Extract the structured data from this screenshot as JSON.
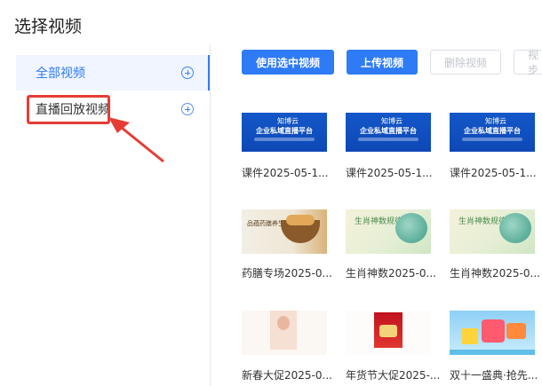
{
  "dialog": {
    "title": "选择视频"
  },
  "sidebar": {
    "items": [
      {
        "label": "全部视频"
      },
      {
        "label": "直播回放视频"
      }
    ]
  },
  "toolbar": {
    "use_selected": "使用选中视频",
    "upload": "上传视频",
    "delete": "删除视频",
    "partial": "视步"
  },
  "thumb_text": {
    "brand": "知博云",
    "headline": "企业私域直播平台",
    "food": "品蕴药膳养生食焕",
    "zodiac": "生肖神数规律学"
  },
  "videos": [
    {
      "caption": "课件2025-05-1..."
    },
    {
      "caption": "课件2025-05-1..."
    },
    {
      "caption": "课件2025-05-1..."
    },
    {
      "caption": "药膳专场2025-0..."
    },
    {
      "caption": "生肖神数2025-0..."
    },
    {
      "caption": "生肖神数2025-0..."
    },
    {
      "caption": "新春大促2025-0..."
    },
    {
      "caption": "年货节大促2025-..."
    },
    {
      "caption": "双十一盛典·抢先..."
    }
  ],
  "colors": {
    "accent": "#2f7bf6",
    "highlight": "#e53d35"
  }
}
